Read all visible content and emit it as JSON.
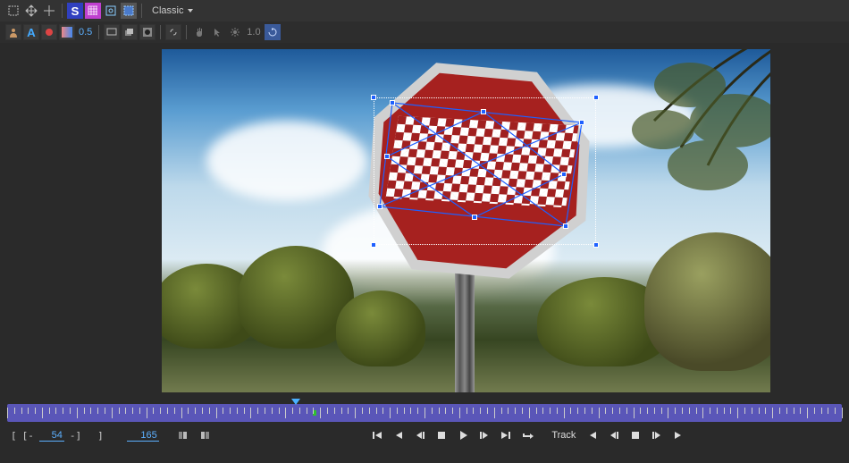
{
  "toolbar": {
    "mode_dropdown": "Classic",
    "opacity_value": "0.5",
    "onion_value": "1.0"
  },
  "viewport": {
    "selection_handles": 8
  },
  "timeline": {
    "start_bracket": "[",
    "range_start_bracket": "[-",
    "range_start": "54",
    "range_start_close": "-]",
    "range_end_bracket": "]",
    "current_frame": "165",
    "track_label": "Track"
  }
}
